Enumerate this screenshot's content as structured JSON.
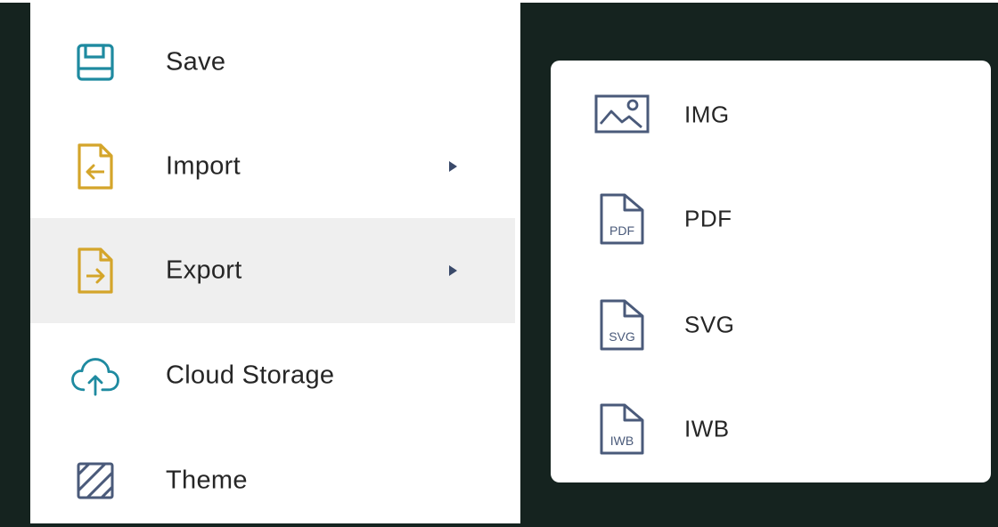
{
  "menu": {
    "items": [
      {
        "label": "Save",
        "icon": "floppy-disk-icon",
        "color": "#1e8aa0"
      },
      {
        "label": "Import",
        "icon": "file-import-icon",
        "color": "#d4a52a",
        "has_submenu": true
      },
      {
        "label": "Export",
        "icon": "file-export-icon",
        "color": "#d4a52a",
        "has_submenu": true,
        "active": true
      },
      {
        "label": "Cloud Storage",
        "icon": "cloud-upload-icon",
        "color": "#1e8aa0"
      },
      {
        "label": "Theme",
        "icon": "theme-hatch-icon",
        "color": "#4a5a7a"
      }
    ]
  },
  "submenu": {
    "parent": "Export",
    "items": [
      {
        "label": "IMG",
        "icon": "image-file-icon"
      },
      {
        "label": "PDF",
        "icon": "pdf-file-icon",
        "badge": "PDF"
      },
      {
        "label": "SVG",
        "icon": "svg-file-icon",
        "badge": "SVG"
      },
      {
        "label": "IWB",
        "icon": "iwb-file-icon",
        "badge": "IWB"
      }
    ]
  },
  "colors": {
    "background_dark": "#15231f",
    "active_row": "#efefef",
    "teal_icon": "#1e8aa0",
    "gold_icon": "#d4a52a",
    "slate_icon": "#4a5a7a"
  }
}
